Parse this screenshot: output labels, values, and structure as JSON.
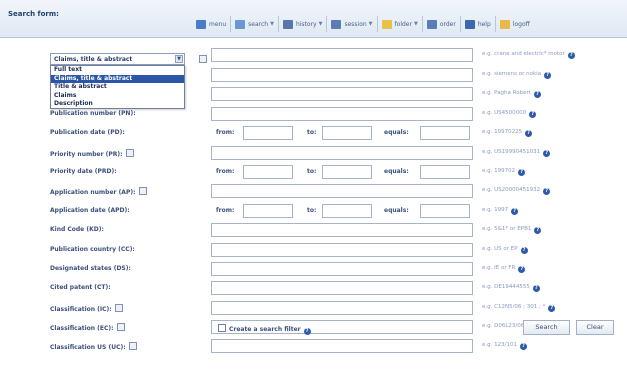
{
  "header": {
    "title": "Search form:"
  },
  "toolbar": [
    {
      "label": "menu",
      "icon": "menu-icon",
      "color": "#4a7cc8",
      "caret": false
    },
    {
      "label": "search",
      "icon": "search-icon",
      "color": "#6b96d6",
      "caret": true
    },
    {
      "label": "history",
      "icon": "history-icon",
      "color": "#5577aa",
      "caret": true
    },
    {
      "label": "session",
      "icon": "session-icon",
      "color": "#5a7db8",
      "caret": true
    },
    {
      "label": "folder",
      "icon": "folder-icon",
      "color": "#e8c14a",
      "caret": true
    },
    {
      "label": "order",
      "icon": "order-icon",
      "color": "#5a7db8",
      "caret": false
    },
    {
      "label": "help",
      "icon": "help-icon",
      "color": "#3d68b0",
      "caret": false
    },
    {
      "label": "logoff",
      "icon": "logoff-icon",
      "color": "#e8b84a",
      "caret": false
    }
  ],
  "field_select": {
    "selected": "Claims, title & abstract",
    "options": [
      "Full text",
      "Claims, title & abstract",
      "Title & abstract",
      "Claims",
      "Description"
    ],
    "selected_index": 1
  },
  "fields": [
    {
      "label": "",
      "hint": "e.g. crane and electric* motor",
      "type": "long",
      "icon": false
    },
    {
      "label": "",
      "hint": "e.g. siemens or nokia",
      "type": "long",
      "icon": false
    },
    {
      "label": "",
      "hint": "e.g. Pagha Robert",
      "type": "long",
      "icon": false
    },
    {
      "label": "Publication number (PN):",
      "hint": "e.g. US4500000",
      "type": "long",
      "icon": false
    },
    {
      "label": "Publication date (PD):",
      "hint": "e.g. 19970225",
      "type": "date",
      "icon": false
    },
    {
      "label": "Priority number (PR):",
      "hint": "e.g. US19990451031",
      "type": "long",
      "icon": true
    },
    {
      "label": "Priority date (PRD):",
      "hint": "e.g. 199702",
      "type": "date",
      "icon": false
    },
    {
      "label": "Application number (AP):",
      "hint": "e.g. US20000451932",
      "type": "long",
      "icon": true
    },
    {
      "label": "Application date (APD):",
      "hint": "e.g. 1997",
      "type": "date",
      "icon": false
    },
    {
      "label": "Kind Code (KD):",
      "hint": "e.g. 5&1* or EPB1",
      "type": "long",
      "icon": false
    },
    {
      "label": "Publication country (CC):",
      "hint": "e.g. US or EP",
      "type": "long",
      "icon": false
    },
    {
      "label": "Designated states (DS):",
      "hint": "e.g. IE or FR",
      "type": "long",
      "icon": false
    },
    {
      "label": "Cited patent (CT):",
      "hint": "e.g. DE19444555",
      "type": "long",
      "icon": false
    },
    {
      "label": "Classification (IC):",
      "hint": "e.g. C12N5/06 ; 301 ; *",
      "type": "long",
      "icon": true
    },
    {
      "label": "Classification (EC):",
      "hint": "e.g. D06L23/06 ; 106 ; C",
      "type": "long",
      "icon": true
    },
    {
      "label": "Classification US (UC):",
      "hint": "e.g. 123/101",
      "type": "long",
      "icon": true
    }
  ],
  "date_labels": {
    "from": "from:",
    "to": "to:",
    "equals": "equals:"
  },
  "footer": {
    "checkbox_label": "Create a search filter",
    "search_button": "Search",
    "clear_button": "Clear"
  },
  "colors": {
    "accent": "#2a55a8",
    "label": "#3a4f7a",
    "hint": "#8a9bbf"
  }
}
